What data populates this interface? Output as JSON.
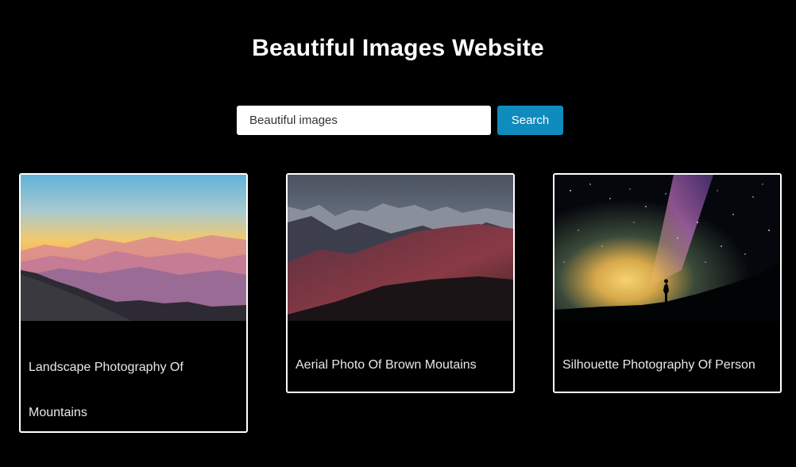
{
  "header": {
    "title": "Beautiful Images Website"
  },
  "search": {
    "value": "Beautiful images",
    "button_label": "Search"
  },
  "cards": [
    {
      "caption": "Landscape Photography Of Mountains",
      "image": "sunset-mountain-landscape"
    },
    {
      "caption": "Aerial Photo Of Brown Moutains",
      "image": "dark-red-mountain-range"
    },
    {
      "caption": "Silhouette Photography Of Person",
      "image": "milky-way-silhouette"
    }
  ],
  "colors": {
    "background": "#000000",
    "accent": "#0f8bbd",
    "card_border": "#ffffff"
  }
}
